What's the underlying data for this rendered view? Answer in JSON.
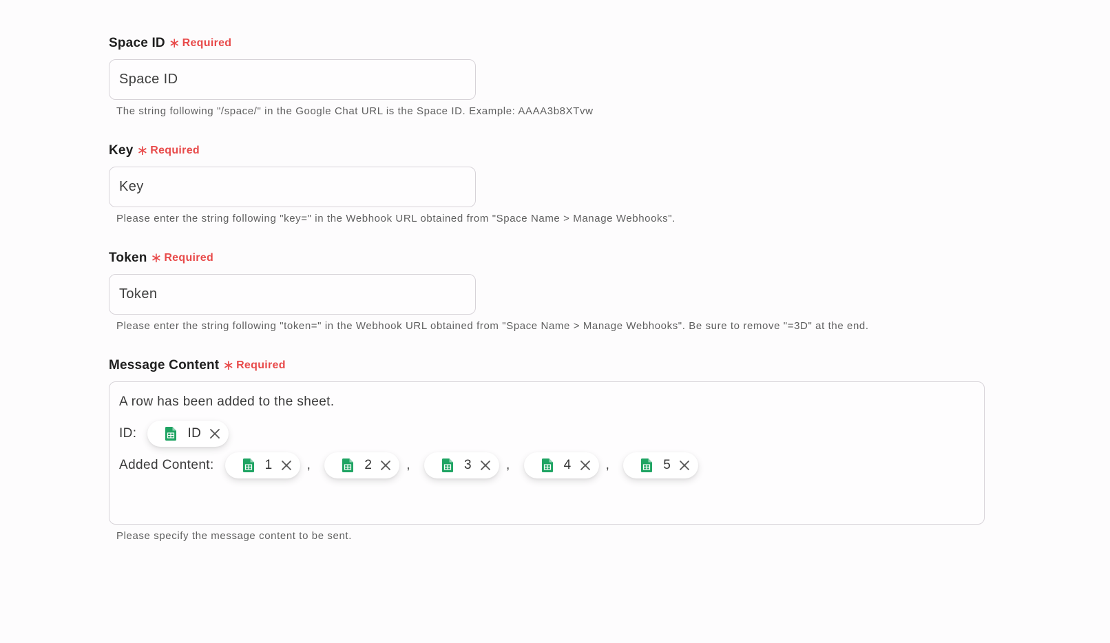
{
  "fields": {
    "space_id": {
      "label": "Space ID",
      "required_mark": "∗",
      "required_label": "Required",
      "placeholder": "Space ID",
      "hint": "The string following \"/space/\" in the Google Chat URL is the Space ID. Example: AAAA3b8XTvw"
    },
    "key": {
      "label": "Key",
      "required_mark": "∗",
      "required_label": "Required",
      "placeholder": "Key",
      "hint": "Please enter the string following \"key=\" in the Webhook URL obtained from \"Space Name > Manage Webhooks\"."
    },
    "token": {
      "label": "Token",
      "required_mark": "∗",
      "required_label": "Required",
      "placeholder": "Token",
      "hint": "Please enter the string following \"token=\" in the Webhook URL obtained from \"Space Name > Manage Webhooks\". Be sure to remove \"=3D\" at the end."
    },
    "message": {
      "label": "Message Content",
      "required_mark": "∗",
      "required_label": "Required",
      "line1": "A row has been added to the sheet.",
      "id_prefix": "ID:",
      "id_chip": "ID",
      "added_prefix": "Added Content:",
      "chips": [
        "1",
        "2",
        "3",
        "4",
        "5"
      ],
      "separator": ",",
      "hint": "Please specify the message content to be sent."
    }
  },
  "colors": {
    "required": "#e84a4a",
    "sheets_icon": "#1fa463"
  },
  "icons": {
    "chip_icon": "google-sheets-icon",
    "chip_remove": "close-icon"
  }
}
